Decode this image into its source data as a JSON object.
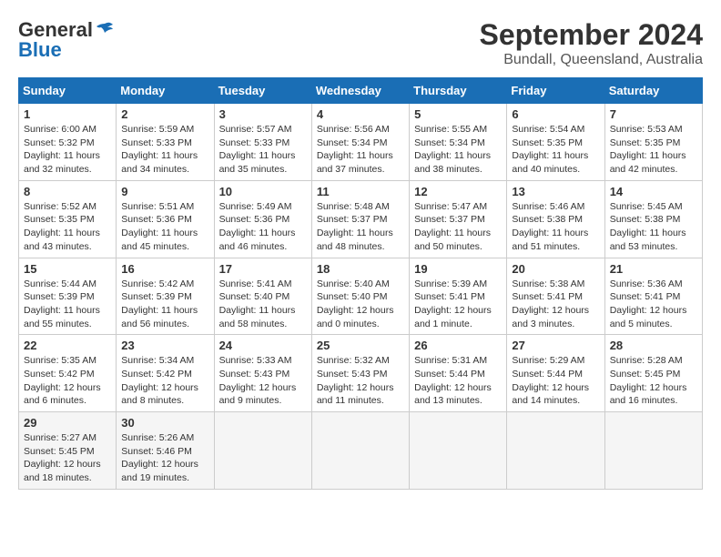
{
  "header": {
    "logo_line1": "General",
    "logo_line2": "Blue",
    "title": "September 2024",
    "subtitle": "Bundall, Queensland, Australia"
  },
  "weekdays": [
    "Sunday",
    "Monday",
    "Tuesday",
    "Wednesday",
    "Thursday",
    "Friday",
    "Saturday"
  ],
  "weeks": [
    [
      {
        "day": "1",
        "sunrise": "6:00 AM",
        "sunset": "5:32 PM",
        "daylight": "11 hours and 32 minutes."
      },
      {
        "day": "2",
        "sunrise": "5:59 AM",
        "sunset": "5:33 PM",
        "daylight": "11 hours and 34 minutes."
      },
      {
        "day": "3",
        "sunrise": "5:57 AM",
        "sunset": "5:33 PM",
        "daylight": "11 hours and 35 minutes."
      },
      {
        "day": "4",
        "sunrise": "5:56 AM",
        "sunset": "5:34 PM",
        "daylight": "11 hours and 37 minutes."
      },
      {
        "day": "5",
        "sunrise": "5:55 AM",
        "sunset": "5:34 PM",
        "daylight": "11 hours and 38 minutes."
      },
      {
        "day": "6",
        "sunrise": "5:54 AM",
        "sunset": "5:35 PM",
        "daylight": "11 hours and 40 minutes."
      },
      {
        "day": "7",
        "sunrise": "5:53 AM",
        "sunset": "5:35 PM",
        "daylight": "11 hours and 42 minutes."
      }
    ],
    [
      {
        "day": "8",
        "sunrise": "5:52 AM",
        "sunset": "5:35 PM",
        "daylight": "11 hours and 43 minutes."
      },
      {
        "day": "9",
        "sunrise": "5:51 AM",
        "sunset": "5:36 PM",
        "daylight": "11 hours and 45 minutes."
      },
      {
        "day": "10",
        "sunrise": "5:49 AM",
        "sunset": "5:36 PM",
        "daylight": "11 hours and 46 minutes."
      },
      {
        "day": "11",
        "sunrise": "5:48 AM",
        "sunset": "5:37 PM",
        "daylight": "11 hours and 48 minutes."
      },
      {
        "day": "12",
        "sunrise": "5:47 AM",
        "sunset": "5:37 PM",
        "daylight": "11 hours and 50 minutes."
      },
      {
        "day": "13",
        "sunrise": "5:46 AM",
        "sunset": "5:38 PM",
        "daylight": "11 hours and 51 minutes."
      },
      {
        "day": "14",
        "sunrise": "5:45 AM",
        "sunset": "5:38 PM",
        "daylight": "11 hours and 53 minutes."
      }
    ],
    [
      {
        "day": "15",
        "sunrise": "5:44 AM",
        "sunset": "5:39 PM",
        "daylight": "11 hours and 55 minutes."
      },
      {
        "day": "16",
        "sunrise": "5:42 AM",
        "sunset": "5:39 PM",
        "daylight": "11 hours and 56 minutes."
      },
      {
        "day": "17",
        "sunrise": "5:41 AM",
        "sunset": "5:40 PM",
        "daylight": "11 hours and 58 minutes."
      },
      {
        "day": "18",
        "sunrise": "5:40 AM",
        "sunset": "5:40 PM",
        "daylight": "12 hours and 0 minutes."
      },
      {
        "day": "19",
        "sunrise": "5:39 AM",
        "sunset": "5:41 PM",
        "daylight": "12 hours and 1 minute."
      },
      {
        "day": "20",
        "sunrise": "5:38 AM",
        "sunset": "5:41 PM",
        "daylight": "12 hours and 3 minutes."
      },
      {
        "day": "21",
        "sunrise": "5:36 AM",
        "sunset": "5:41 PM",
        "daylight": "12 hours and 5 minutes."
      }
    ],
    [
      {
        "day": "22",
        "sunrise": "5:35 AM",
        "sunset": "5:42 PM",
        "daylight": "12 hours and 6 minutes."
      },
      {
        "day": "23",
        "sunrise": "5:34 AM",
        "sunset": "5:42 PM",
        "daylight": "12 hours and 8 minutes."
      },
      {
        "day": "24",
        "sunrise": "5:33 AM",
        "sunset": "5:43 PM",
        "daylight": "12 hours and 9 minutes."
      },
      {
        "day": "25",
        "sunrise": "5:32 AM",
        "sunset": "5:43 PM",
        "daylight": "12 hours and 11 minutes."
      },
      {
        "day": "26",
        "sunrise": "5:31 AM",
        "sunset": "5:44 PM",
        "daylight": "12 hours and 13 minutes."
      },
      {
        "day": "27",
        "sunrise": "5:29 AM",
        "sunset": "5:44 PM",
        "daylight": "12 hours and 14 minutes."
      },
      {
        "day": "28",
        "sunrise": "5:28 AM",
        "sunset": "5:45 PM",
        "daylight": "12 hours and 16 minutes."
      }
    ],
    [
      {
        "day": "29",
        "sunrise": "5:27 AM",
        "sunset": "5:45 PM",
        "daylight": "12 hours and 18 minutes."
      },
      {
        "day": "30",
        "sunrise": "5:26 AM",
        "sunset": "5:46 PM",
        "daylight": "12 hours and 19 minutes."
      },
      null,
      null,
      null,
      null,
      null
    ]
  ]
}
